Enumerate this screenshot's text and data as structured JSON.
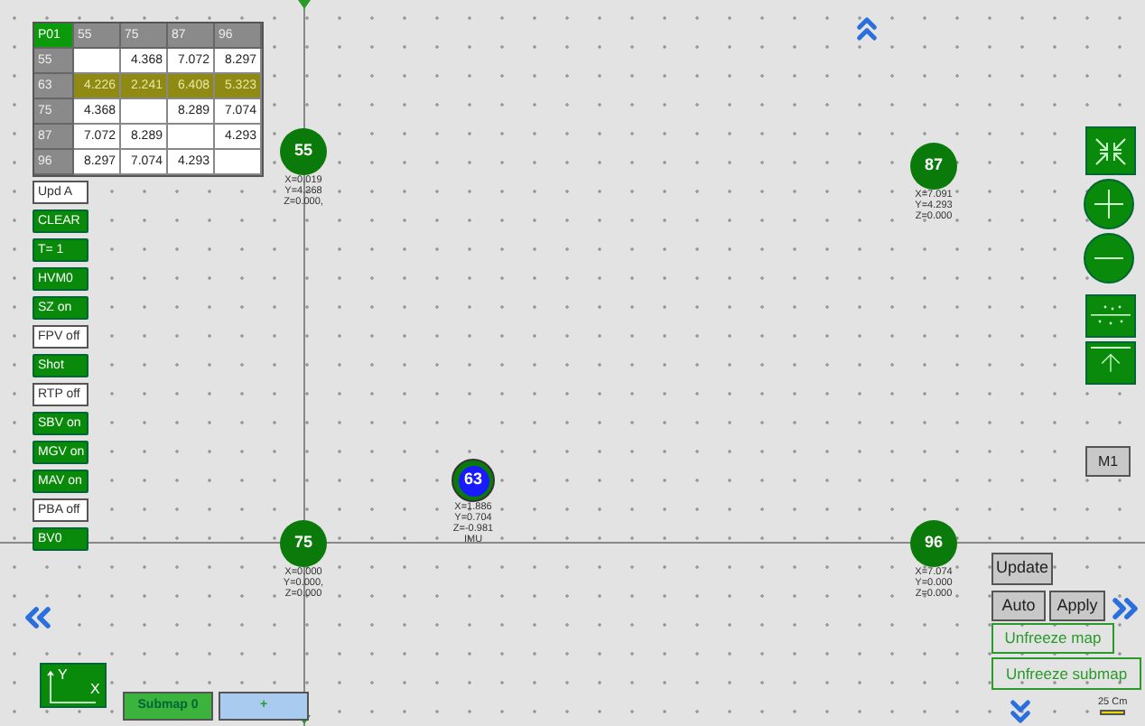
{
  "table": {
    "corner": "P01",
    "columns": [
      "55",
      "75",
      "87",
      "96"
    ],
    "rows": [
      {
        "label": "55",
        "highlighted": false,
        "cells": [
          "",
          "4.368",
          "7.072",
          "8.297"
        ]
      },
      {
        "label": "63",
        "highlighted": true,
        "cells": [
          "4.226",
          "2.241",
          "6.408",
          "5.323"
        ]
      },
      {
        "label": "75",
        "highlighted": false,
        "cells": [
          "4.368",
          "",
          "8.289",
          "7.074"
        ]
      },
      {
        "label": "87",
        "highlighted": false,
        "cells": [
          "7.072",
          "8.289",
          "",
          "4.293"
        ]
      },
      {
        "label": "96",
        "highlighted": false,
        "cells": [
          "8.297",
          "7.074",
          "4.293",
          ""
        ]
      }
    ]
  },
  "toggles": [
    {
      "label": "Upd A",
      "on": false
    },
    {
      "label": "CLEAR",
      "on": true
    },
    {
      "label": "T= 1",
      "on": true
    },
    {
      "label": "HVM0",
      "on": true
    },
    {
      "label": "SZ on",
      "on": true
    },
    {
      "label": "FPV off",
      "on": false
    },
    {
      "label": "Shot",
      "on": true
    },
    {
      "label": "RTP off",
      "on": false
    },
    {
      "label": "SBV on",
      "on": true
    },
    {
      "label": "MGV on",
      "on": true
    },
    {
      "label": "MAV on",
      "on": true
    },
    {
      "label": "PBA off",
      "on": false
    },
    {
      "label": "BV0",
      "on": true
    }
  ],
  "nodes": [
    {
      "kind": "anchor",
      "label": "55",
      "coords": [
        "X=0.019",
        "Y=4.368",
        "Z=0.000,"
      ]
    },
    {
      "kind": "anchor",
      "label": "87",
      "coords": [
        "X=7.091",
        "Y=4.293",
        "Z=0.000"
      ]
    },
    {
      "kind": "imu",
      "label": "63",
      "coords": [
        "X=1.886",
        "Y=0.704",
        "Z=-0.981",
        "IMU"
      ]
    },
    {
      "kind": "anchor",
      "label": "75",
      "coords": [
        "X=0.000",
        "Y=0.000,",
        "Z=0.000"
      ]
    },
    {
      "kind": "anchor",
      "label": "96",
      "coords": [
        "X=7.074",
        "Y=0.000",
        "Z=0.000"
      ]
    }
  ],
  "m1_button": "M1",
  "update_button": "Update",
  "auto_button": "Auto",
  "apply_button": "Apply",
  "unfreeze_map_button": "Unfreeze map",
  "unfreeze_submap_button": "Unfreeze submap",
  "axes_labels": [
    "Y",
    "X"
  ],
  "scale": "25 Cm",
  "submap_tabs": [
    {
      "label": "Submap 0",
      "selected": true
    },
    {
      "label": "+",
      "selected": false
    }
  ]
}
